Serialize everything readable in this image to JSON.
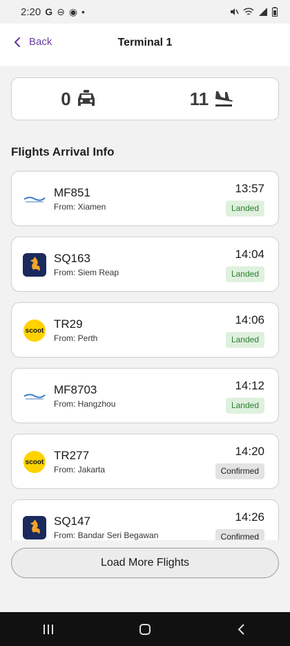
{
  "status_bar": {
    "time": "2:20",
    "left_icons": [
      "google-icon",
      "minus-circle-icon",
      "target-icon",
      "dot-icon"
    ],
    "right_icons": [
      "mute-icon",
      "wifi-icon",
      "signal-icon",
      "battery-icon"
    ]
  },
  "header": {
    "back_label": "Back",
    "title": "Terminal 1"
  },
  "summary": {
    "taxi_count": "0",
    "arrival_count": "11"
  },
  "section_title": "Flights Arrival Info",
  "flights": [
    {
      "number": "MF851",
      "from": "From: Xiamen",
      "time": "13:57",
      "status": "Landed",
      "airline_logo": "xiamen-airlines-logo"
    },
    {
      "number": "SQ163",
      "from": "From: Siem Reap",
      "time": "14:04",
      "status": "Landed",
      "airline_logo": "singapore-airlines-logo"
    },
    {
      "number": "TR29",
      "from": "From: Perth",
      "time": "14:06",
      "status": "Landed",
      "airline_logo": "scoot-logo"
    },
    {
      "number": "MF8703",
      "from": "From: Hangzhou",
      "time": "14:12",
      "status": "Landed",
      "airline_logo": "xiamen-airlines-logo"
    },
    {
      "number": "TR277",
      "from": "From: Jakarta",
      "time": "14:20",
      "status": "Confirmed",
      "airline_logo": "scoot-logo"
    },
    {
      "number": "SQ147",
      "from": "From: Bandar Seri Begawan",
      "time": "14:26",
      "status": "Confirmed",
      "airline_logo": "singapore-airlines-logo"
    }
  ],
  "scoot_logo_text": "scoot",
  "load_more_label": "Load More Flights",
  "colors": {
    "accent": "#6b3fa0",
    "landed_bg": "#dff1de",
    "landed_text": "#2b7d2f",
    "confirmed_bg": "#e3e3e3"
  }
}
